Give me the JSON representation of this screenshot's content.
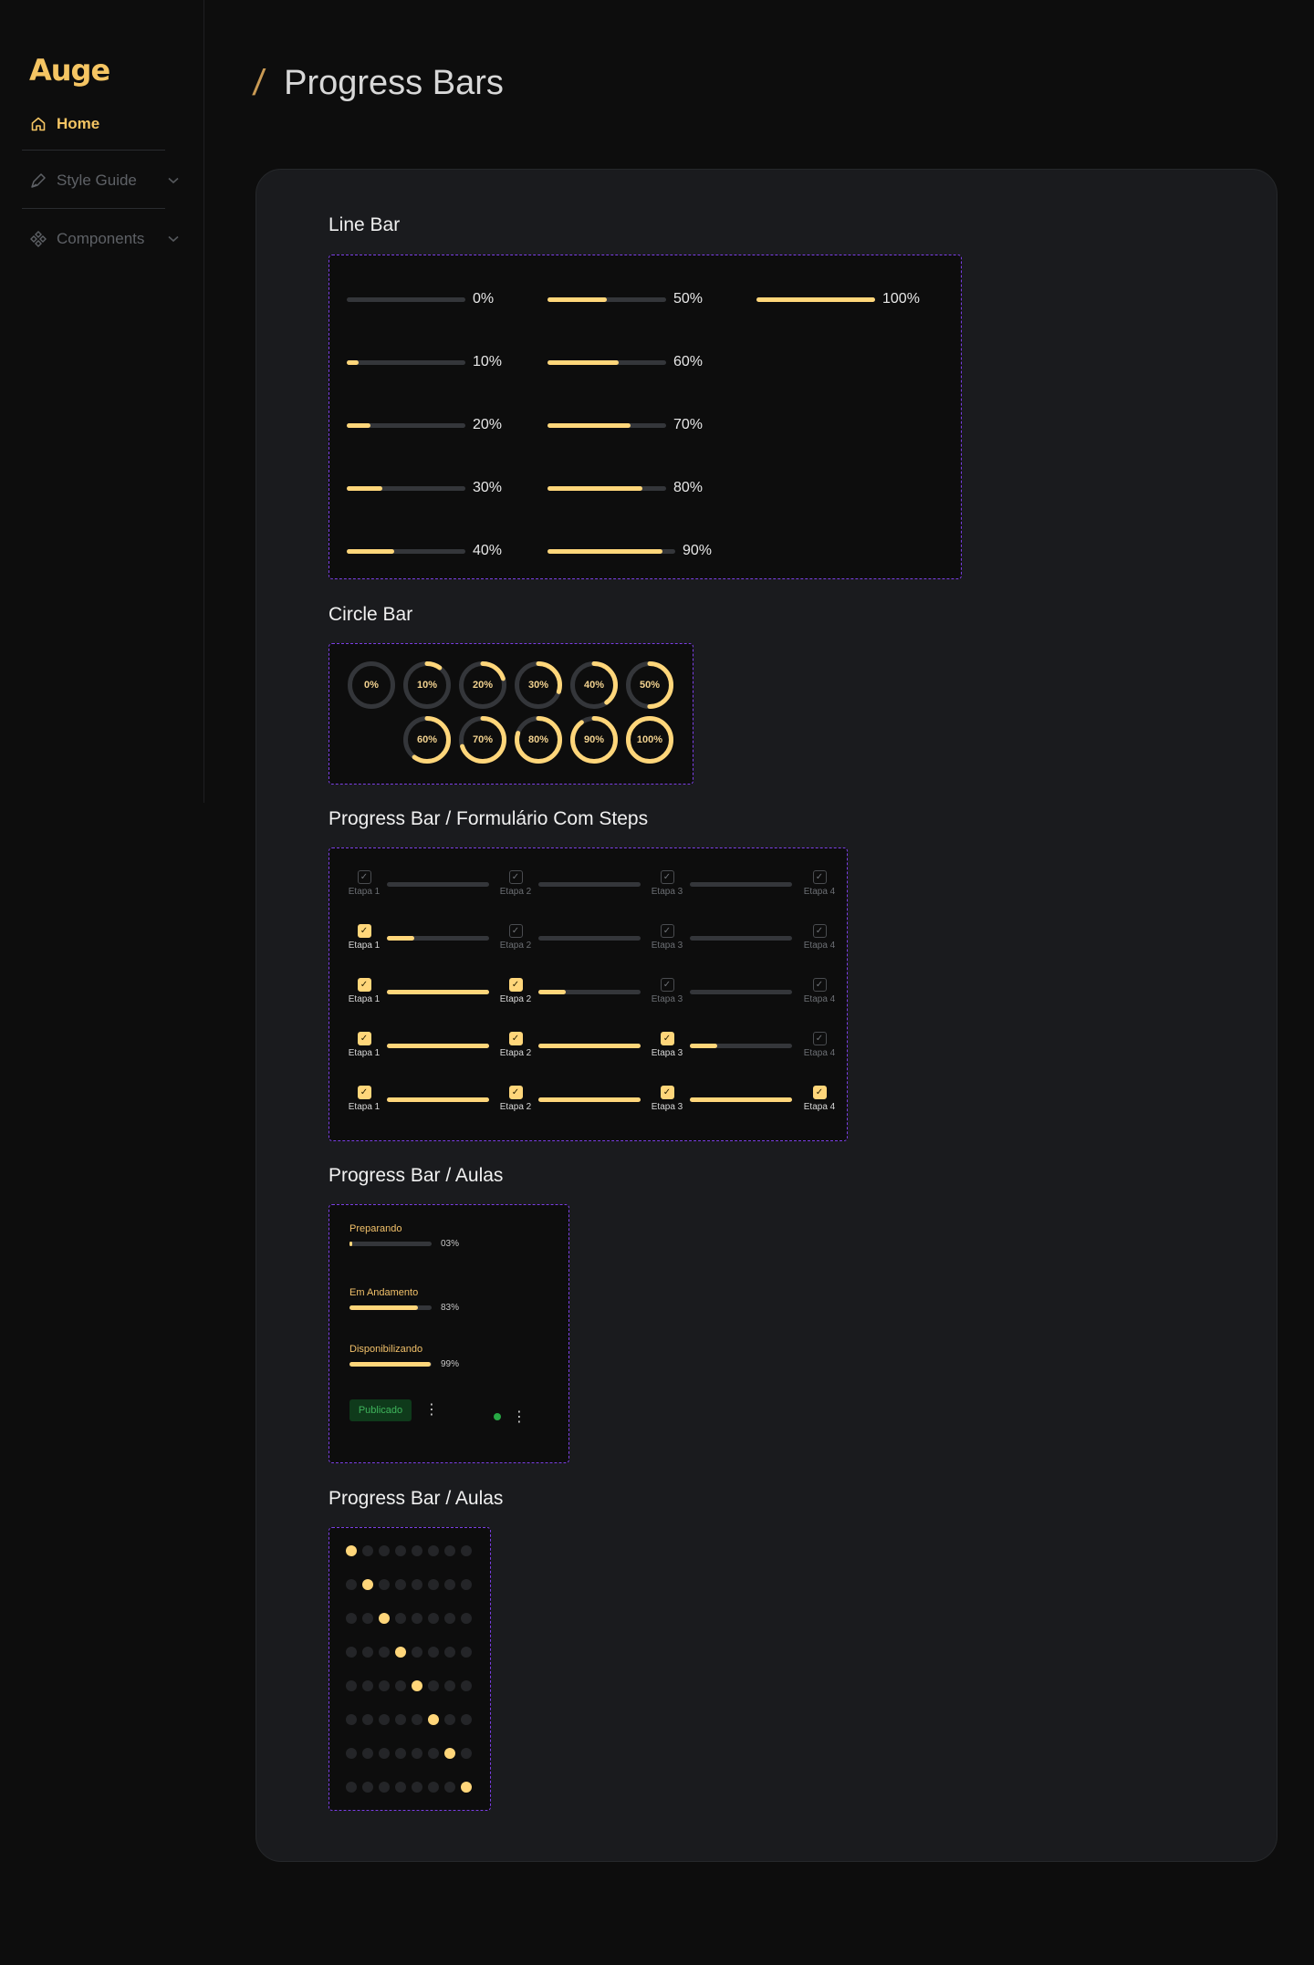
{
  "sidebar": {
    "logo": "Auge",
    "items": [
      {
        "label": "Home",
        "icon": "home-icon",
        "active": true
      },
      {
        "label": "Style Guide",
        "icon": "pen-icon",
        "has_children": true
      },
      {
        "label": "Components",
        "icon": "components-icon",
        "has_children": true
      }
    ]
  },
  "header": {
    "slash": "/",
    "title": "Progress Bars"
  },
  "colors": {
    "accent": "#ffd67a",
    "track": "#34363a",
    "card": "#1a1b1e",
    "dashed_border": "#7b3fe4",
    "badge_green": "#3fb45c"
  },
  "line_bar": {
    "title": "Line Bar",
    "bars": [
      {
        "value": 0,
        "label": "0%"
      },
      {
        "value": 10,
        "label": "10%"
      },
      {
        "value": 20,
        "label": "20%"
      },
      {
        "value": 30,
        "label": "30%"
      },
      {
        "value": 40,
        "label": "40%"
      },
      {
        "value": 50,
        "label": "50%"
      },
      {
        "value": 60,
        "label": "60%"
      },
      {
        "value": 70,
        "label": "70%"
      },
      {
        "value": 80,
        "label": "80%"
      },
      {
        "value": 90,
        "label": "90%"
      },
      {
        "value": 100,
        "label": "100%"
      }
    ]
  },
  "circle_bar": {
    "title": "Circle Bar",
    "circles": [
      {
        "value": 0,
        "label": "0%"
      },
      {
        "value": 10,
        "label": "10%"
      },
      {
        "value": 20,
        "label": "20%"
      },
      {
        "value": 30,
        "label": "30%"
      },
      {
        "value": 40,
        "label": "40%"
      },
      {
        "value": 50,
        "label": "50%"
      },
      {
        "value": 60,
        "label": "60%"
      },
      {
        "value": 70,
        "label": "70%"
      },
      {
        "value": 80,
        "label": "80%"
      },
      {
        "value": 90,
        "label": "90%"
      },
      {
        "value": 100,
        "label": "100%"
      }
    ]
  },
  "steps": {
    "title": "Progress Bar / Formulário Com Steps",
    "step_labels": [
      "Etapa 1",
      "Etapa 2",
      "Etapa 3",
      "Etapa 4"
    ],
    "rows": [
      {
        "checked": [
          false,
          false,
          false,
          false
        ],
        "segments": [
          0,
          0,
          0
        ]
      },
      {
        "checked": [
          true,
          false,
          false,
          false
        ],
        "segments": [
          0.27,
          0,
          0
        ]
      },
      {
        "checked": [
          true,
          true,
          false,
          false
        ],
        "segments": [
          1,
          0.27,
          0
        ]
      },
      {
        "checked": [
          true,
          true,
          true,
          false
        ],
        "segments": [
          1,
          1,
          0.27
        ]
      },
      {
        "checked": [
          true,
          true,
          true,
          true
        ],
        "segments": [
          1,
          1,
          1
        ]
      }
    ]
  },
  "aulas": {
    "title": "Progress Bar / Aulas",
    "items": [
      {
        "label": "Preparando",
        "value": 3,
        "pct": "03%"
      },
      {
        "label": "Em Andamento",
        "value": 83,
        "pct": "83%"
      },
      {
        "label": "Disponibilizando",
        "value": 99,
        "pct": "99%"
      }
    ],
    "badge": "Publicado",
    "menu_glyph": "⋮"
  },
  "dots": {
    "title": "Progress Bar / Aulas",
    "count": 8,
    "rows": [
      0,
      1,
      2,
      3,
      4,
      5,
      6,
      7
    ]
  }
}
